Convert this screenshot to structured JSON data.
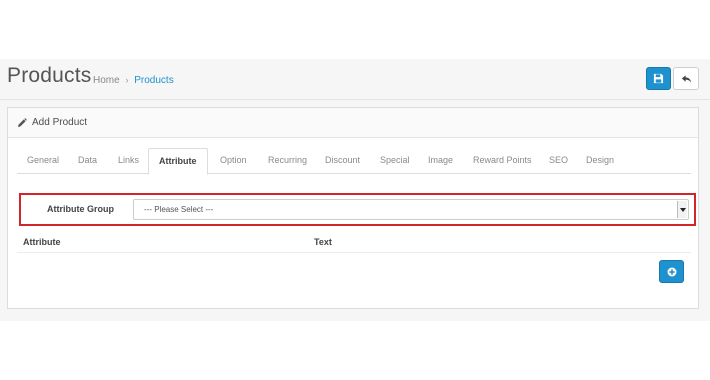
{
  "header": {
    "title": "Products",
    "breadcrumb": [
      {
        "label": "Home"
      },
      {
        "label": "Products"
      }
    ],
    "breadcrumb_separator": "›",
    "save_icon": "save-icon",
    "back_icon": "reply-icon"
  },
  "panel": {
    "title": "Add Product",
    "icon": "pencil-icon"
  },
  "tabs": [
    "General",
    "Data",
    "Links",
    "Attribute",
    "Option",
    "Recurring",
    "Discount",
    "Special",
    "Image",
    "Reward Points",
    "SEO",
    "Design"
  ],
  "active_tab": "Attribute",
  "attribute_group": {
    "label": "Attribute Group",
    "selected_value": "--- Please Select ---"
  },
  "table": {
    "columns": [
      "Attribute",
      "Text"
    ]
  },
  "add_button_icon": "plus-circle-icon",
  "colors": {
    "primary": "#1e91cf",
    "highlight": "#d0252b",
    "link": "#1e91cf"
  }
}
